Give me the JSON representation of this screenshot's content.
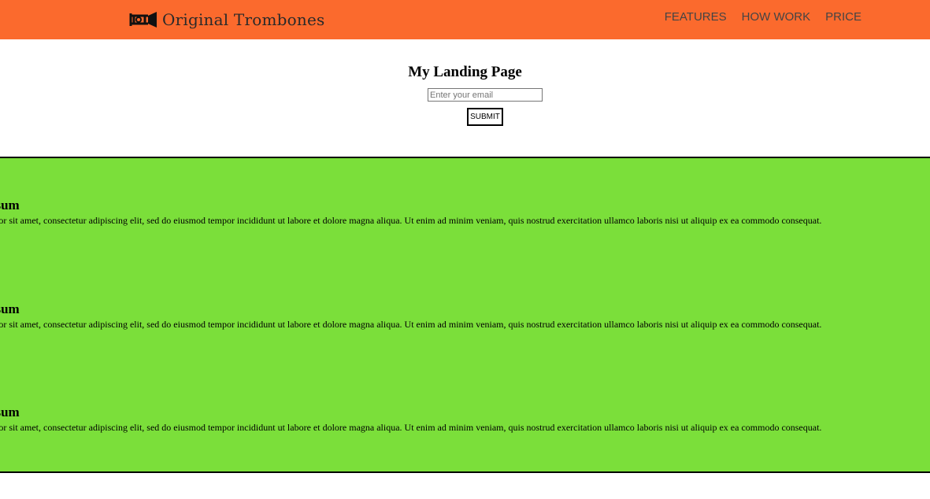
{
  "header": {
    "brand": "Original Trombones",
    "logo_icon": "trombone-icon",
    "nav": [
      {
        "label": "FEATURES"
      },
      {
        "label": "HOW WORK"
      },
      {
        "label": "PRICE"
      }
    ],
    "background_color": "#fb6a2d"
  },
  "hero": {
    "title": "My Landing Page",
    "email_placeholder": "Enter your email",
    "submit_label": "SUBMIT"
  },
  "features": {
    "background_color": "#7bdf3a",
    "items": [
      {
        "heading": "m Ipsum",
        "text": "sum dolor sit amet, consectetur adipiscing elit, sed do eiusmod tempor incididunt ut labore et dolore magna aliqua. Ut enim ad minim veniam, quis nostrud exercitation ullamco laboris nisi ut aliquip ex ea commodo consequat."
      },
      {
        "heading": "m Ipsum",
        "text": "sum dolor sit amet, consectetur adipiscing elit, sed do eiusmod tempor incididunt ut labore et dolore magna aliqua. Ut enim ad minim veniam, quis nostrud exercitation ullamco laboris nisi ut aliquip ex ea commodo consequat."
      },
      {
        "heading": "m Ipsum",
        "text": "sum dolor sit amet, consectetur adipiscing elit, sed do eiusmod tempor incididunt ut labore et dolore magna aliqua. Ut enim ad minim veniam, quis nostrud exercitation ullamco laboris nisi ut aliquip ex ea commodo consequat."
      }
    ]
  }
}
